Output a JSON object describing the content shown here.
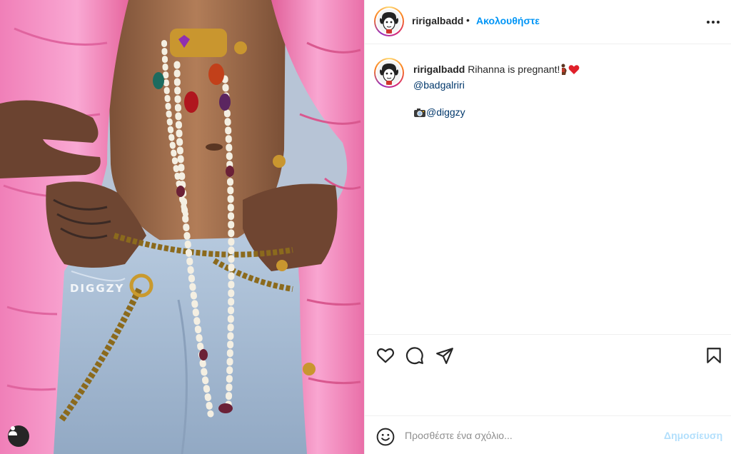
{
  "post": {
    "username": "ririgalbadd",
    "separator": "•",
    "follow_label": "Ακολουθήστε",
    "more_icon": "more-horizontal-icon",
    "caption": {
      "text": "Rihanna is pregnant!",
      "mention": "@badgalriri",
      "photo_credit_icon": "camera-icon",
      "photo_credit": "@diggzy"
    },
    "photo": {
      "watermark": "DIGGZY",
      "user_tag_icon": "user-icon"
    }
  },
  "actions": {
    "like_icon": "heart-icon",
    "comment_icon": "comment-icon",
    "share_icon": "share-icon",
    "save_icon": "bookmark-icon"
  },
  "comment": {
    "emoji_icon": "smiley-icon",
    "placeholder": "Προσθέστε ένα σχόλιο...",
    "post_label": "Δημοσίευση"
  },
  "colors": {
    "link_blue": "#0095f6",
    "mention_blue": "#00376b",
    "disabled_blue": "#b2dffc",
    "jacket_pink": "#f590c4",
    "denim_blue": "#a9bfd8"
  }
}
